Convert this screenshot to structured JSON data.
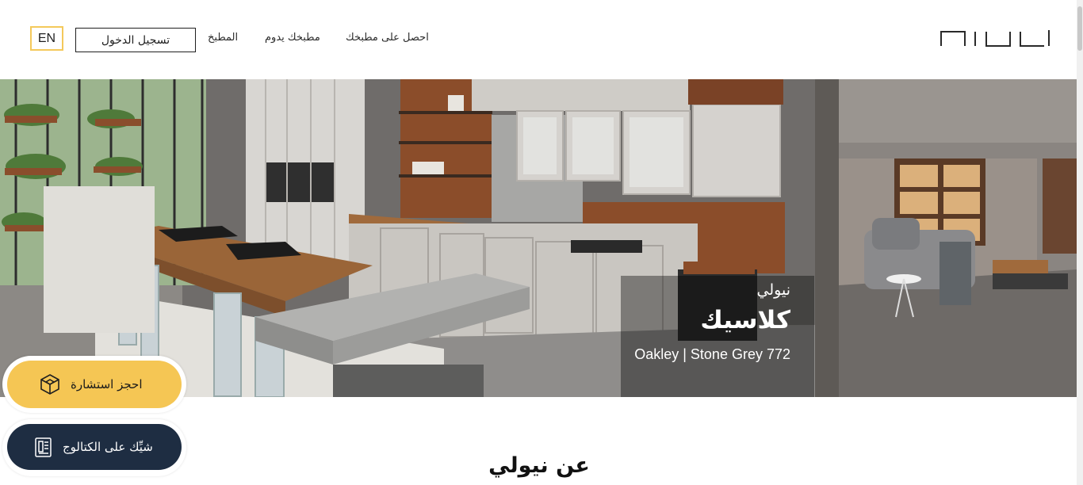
{
  "header": {
    "lang_label": "EN",
    "login_label": "تسجيل الدخول",
    "nav": {
      "kitchen": "المطبخ",
      "kitchen_day": "مطبخك يدوم",
      "get_kitchen": "احصل على مطبخك"
    },
    "logo_icon": "nolte-logo"
  },
  "hero": {
    "brand": "نيولي",
    "title": "كلاسيك",
    "subtitle": "Oakley | Stone Grey 772"
  },
  "buttons": {
    "consult_label": "احجز استشارة",
    "catalog_label": "شيِّك على الكتالوج"
  },
  "about": {
    "title": "عن نيولي"
  },
  "colors": {
    "accent": "#f5c654",
    "dark_button": "#1e2d42"
  }
}
